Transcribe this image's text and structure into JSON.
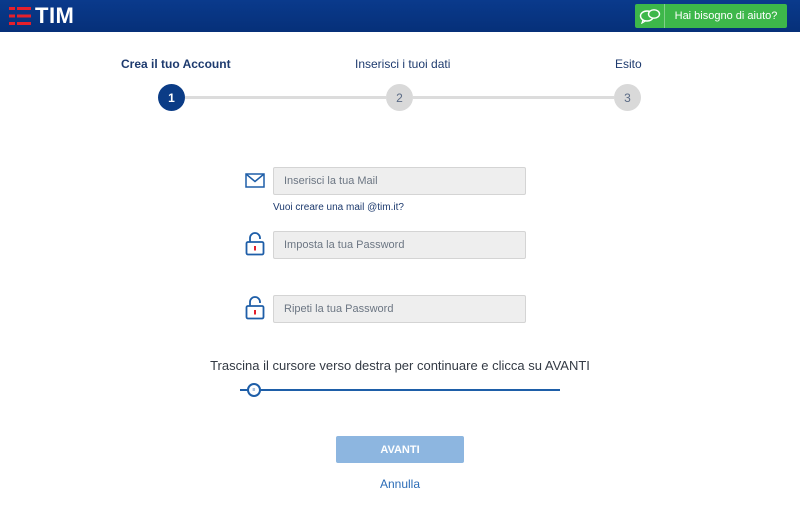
{
  "header": {
    "logo_text": "TIM",
    "help_label": "Hai bisogno di aiuto?",
    "help_icon": "chat-bubbles-icon"
  },
  "stepper": {
    "steps": [
      {
        "label": "Crea il tuo Account",
        "number": "1",
        "active": true
      },
      {
        "label": "Inserisci i tuoi dati",
        "number": "2",
        "active": false
      },
      {
        "label": "Esito",
        "number": "3",
        "active": false
      }
    ]
  },
  "form": {
    "email_placeholder": "Inserisci la tua Mail",
    "email_value": "",
    "mail_link": "Vuoi creare una mail @tim.it?",
    "password_placeholder": "Imposta la tua Password",
    "password_value": "",
    "repeat_password_placeholder": "Ripeti la tua Password",
    "repeat_password_value": ""
  },
  "slider": {
    "instruction": "Trascina il cursore verso destra per continuare e clicca su AVANTI",
    "thumb_glyph": "≡",
    "progress": 0
  },
  "actions": {
    "avanti_label": "AVANTI",
    "annulla_label": "Annulla"
  },
  "colors": {
    "brand_blue": "#0b3c86",
    "help_green": "#3db74a",
    "button_disabled": "#8db6e0",
    "logo_red": "#e4202c"
  }
}
